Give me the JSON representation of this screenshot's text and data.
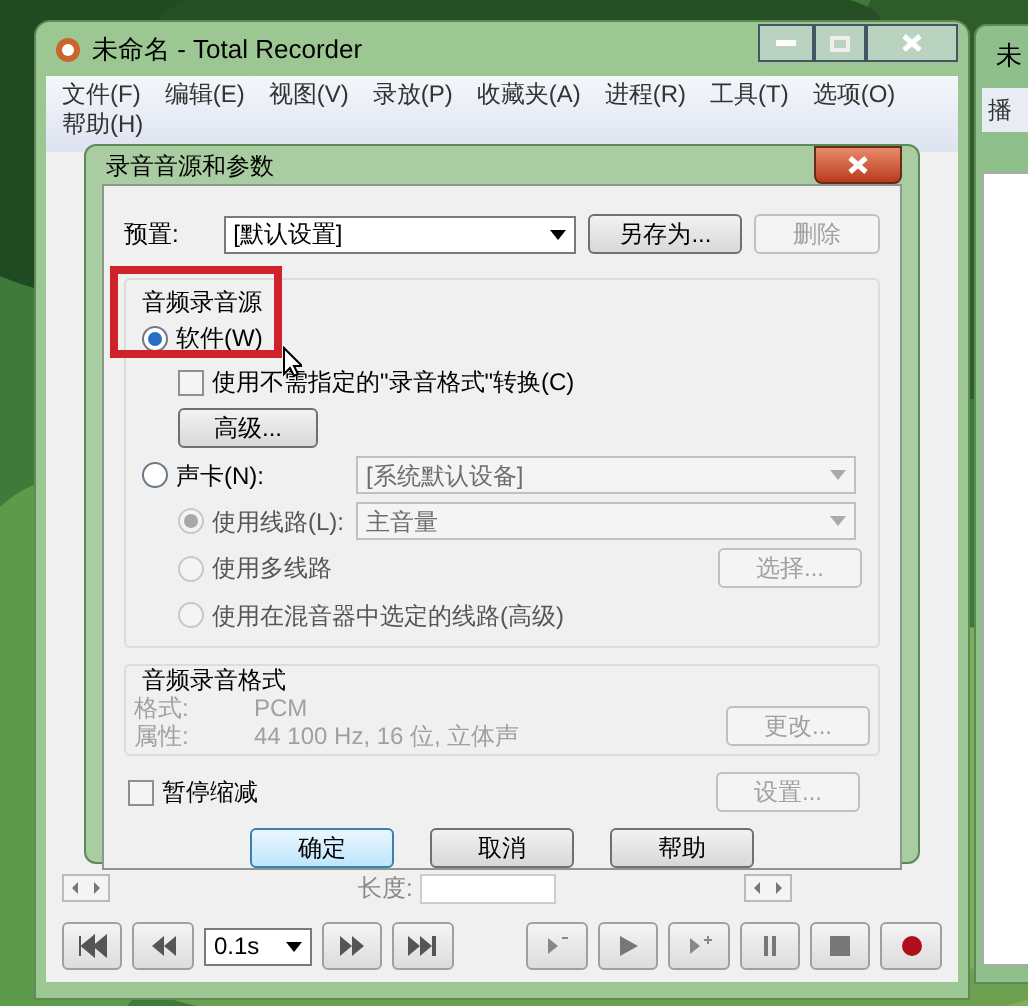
{
  "main_window": {
    "title": "未命名 - Total Recorder",
    "menu": [
      "文件(F)",
      "编辑(E)",
      "视图(V)",
      "录放(P)",
      "收藏夹(A)",
      "进程(R)",
      "工具(T)",
      "选项(O)",
      "帮助(H)"
    ],
    "length_label": "长度:",
    "step": "0.1s"
  },
  "side_window": {
    "title": "未",
    "tab": "播"
  },
  "dialog": {
    "title": "录音音源和参数",
    "preset_label": "预置:",
    "preset_value": "[默认设置]",
    "save_as": {
      "label": "另存为...",
      "disabled": false
    },
    "delete": {
      "label": "删除",
      "disabled": true
    },
    "source": {
      "legend": "音频录音源",
      "highlighted": true,
      "software": {
        "label": "软件(W)",
        "selected": true
      },
      "convert": {
        "label": "使用不需指定的\"录音格式\"转换(C)",
        "checked": false
      },
      "advanced": {
        "label": "高级...",
        "disabled": false
      },
      "soundcard": {
        "label": "声卡(N):",
        "selected": false,
        "device": "[系统默认设备]"
      },
      "lines": [
        {
          "label": "使用线路(L):",
          "selected": true,
          "disabled": true,
          "combo": "主音量"
        },
        {
          "label": "使用多线路",
          "selected": false,
          "disabled": true,
          "button": "选择..."
        },
        {
          "label": "使用在混音器中选定的线路(高级)",
          "selected": false,
          "disabled": true
        }
      ]
    },
    "format": {
      "legend": "音频录音格式",
      "rows": [
        {
          "label": "格式:",
          "value": "PCM"
        },
        {
          "label": "属性:",
          "value": "44 100 Hz, 16 位, 立体声"
        }
      ],
      "change": {
        "label": "更改...",
        "disabled": true
      }
    },
    "pause_reduce": {
      "label": "暂停缩减",
      "checked": false
    },
    "settings": {
      "label": "设置...",
      "disabled": true
    },
    "buttons": [
      {
        "label": "确定",
        "default": true
      },
      {
        "label": "取消",
        "default": false
      },
      {
        "label": "帮助",
        "default": false
      }
    ]
  }
}
